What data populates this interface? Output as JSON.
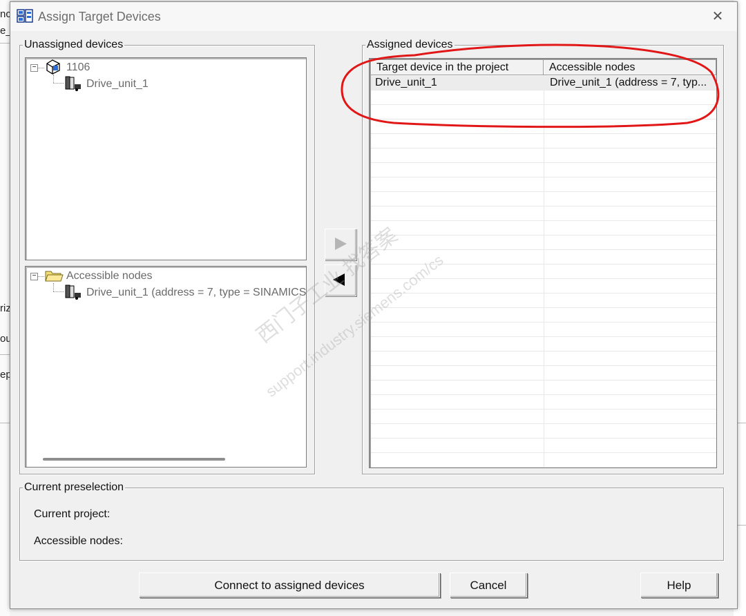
{
  "background": {
    "left_fragments": [
      "nc",
      "e_",
      "riz",
      "ou",
      "ep"
    ]
  },
  "dialog": {
    "title": "Assign Target Devices",
    "close_glyph": "✕"
  },
  "unassigned": {
    "legend": "Unassigned devices",
    "root_label": "1106",
    "child_label": "Drive_unit_1"
  },
  "accessible_tree": {
    "root_label": "Accessible nodes",
    "child_label": "Drive_unit_1 (address = 7, type = SINAMICS"
  },
  "assigned": {
    "legend": "Assigned devices",
    "columns": [
      "Target device in the project",
      "Accessible nodes"
    ],
    "rows": [
      {
        "target": "Drive_unit_1",
        "node": "Drive_unit_1 (address = 7, typ..."
      }
    ]
  },
  "arrows": {
    "assign": "right-arrow-icon",
    "unassign": "left-arrow-icon"
  },
  "preselection": {
    "legend": "Current preselection",
    "project_label": "Current project:",
    "nodes_label": "Accessible nodes:"
  },
  "buttons": {
    "connect": "Connect to assigned devices",
    "cancel": "Cancel",
    "help": "Help"
  },
  "watermark": {
    "line1": "西门子工业   找答案",
    "line2": "support.industry.siemens.com/cs"
  },
  "colors": {
    "highlight_circle": "#e11717"
  }
}
